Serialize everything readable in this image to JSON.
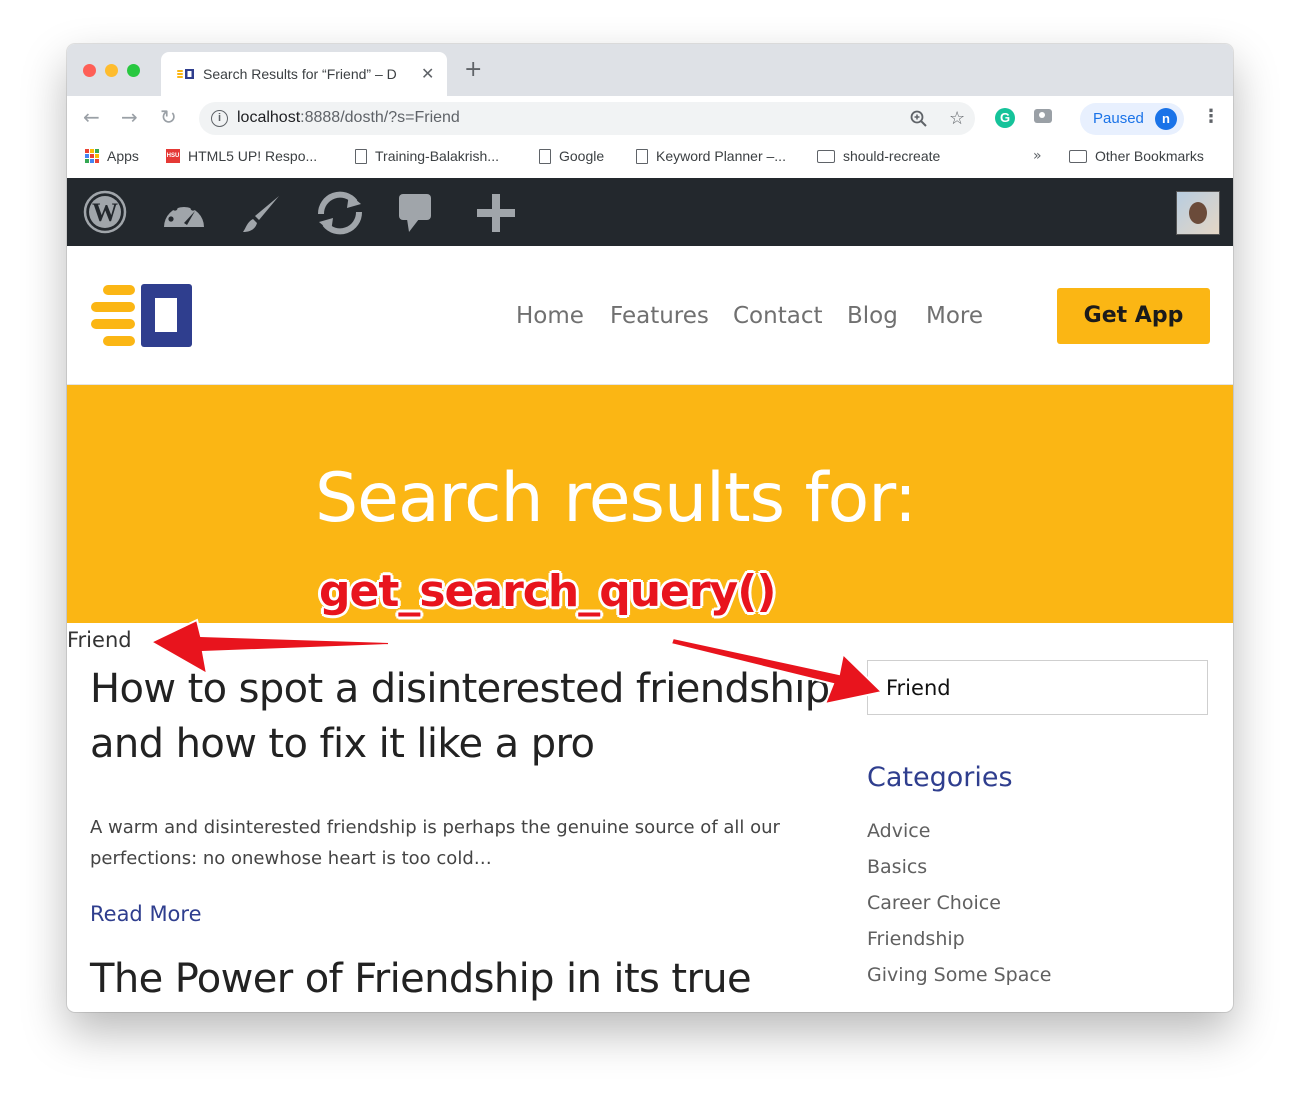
{
  "browser": {
    "tab_title": "Search Results for “Friend” – D",
    "new_tab": "+",
    "tab_close": "✕",
    "url_host": "localhost",
    "url_rest": ":8888/dosth/?s=Friend",
    "profile_label": "Paused",
    "profile_initial": "n",
    "bookmarks": [
      {
        "label": "Apps",
        "icon": "apps-grid-icon"
      },
      {
        "label": "HTML5 UP! Respo...",
        "icon": "hsu-favicon-icon"
      },
      {
        "label": "Training-Balakrish...",
        "icon": "page-icon"
      },
      {
        "label": "Google",
        "icon": "page-icon"
      },
      {
        "label": "Keyword Planner –...",
        "icon": "page-icon"
      },
      {
        "label": "should-recreate",
        "icon": "folder-icon"
      },
      {
        "label": "Other Bookmarks",
        "icon": "folder-icon"
      }
    ],
    "bookmarks_overflow": "»"
  },
  "admin_bar": {
    "icons": [
      "wordpress-logo-icon",
      "dashboard-icon",
      "customize-brush-icon",
      "updates-icon",
      "comments-icon",
      "new-content-icon"
    ]
  },
  "site": {
    "nav": [
      "Home",
      "Features",
      "Contact",
      "Blog",
      "More"
    ],
    "cta": "Get App",
    "hero_title": "Search results for:",
    "search_query": "Friend",
    "search_input_value": "Friend",
    "posts": [
      {
        "title": "How to spot a disinterested friendship and how to fix it like a pro",
        "excerpt": "A warm and disinterested friendship is perhaps the genuine source of all our perfections: no onewhose heart is too cold…",
        "read_more": "Read More"
      },
      {
        "title": "The Power of Friendship in its true"
      }
    ],
    "categories_heading": "Categories",
    "categories": [
      "Advice",
      "Basics",
      "Career Choice",
      "Friendship",
      "Giving Some Space"
    ]
  },
  "annotation": {
    "code_label": "get_search_query()",
    "color": "#e8141d"
  },
  "colors": {
    "accent_yellow": "#fbb614",
    "brand_blue": "#2f3e8e",
    "admin_bar": "#23282d"
  }
}
